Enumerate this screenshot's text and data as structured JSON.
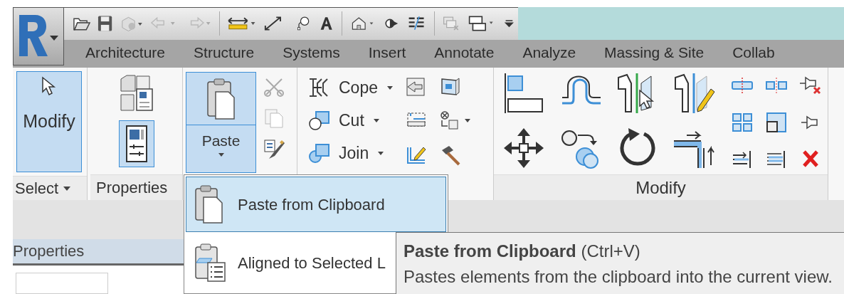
{
  "tabs": [
    {
      "label": "Architecture"
    },
    {
      "label": "Structure"
    },
    {
      "label": "Systems"
    },
    {
      "label": "Insert"
    },
    {
      "label": "Annotate"
    },
    {
      "label": "Analyze"
    },
    {
      "label": "Massing & Site"
    },
    {
      "label": "Collab"
    }
  ],
  "ribbon": {
    "modify_button": {
      "label": "Modify",
      "selected": true
    },
    "select_panel": {
      "label": "Select"
    },
    "properties_panel": {
      "label": "Properties",
      "properties_button_selected": true
    },
    "paste_button": {
      "label": "Paste",
      "selected": true
    },
    "geometry_tools": [
      {
        "label": "Cope"
      },
      {
        "label": "Cut"
      },
      {
        "label": "Join"
      }
    ],
    "modify_panel": {
      "label": "Modify"
    }
  },
  "properties_palette": {
    "title": "Properties"
  },
  "paste_menu": [
    {
      "label": "Paste from Clipboard",
      "selected": true
    },
    {
      "label": "Aligned to Selected L",
      "selected": false
    }
  ],
  "tooltip": {
    "title": "Paste from Clipboard",
    "shortcut": "(Ctrl+V)",
    "description": "Pastes elements from the clipboard into the current view."
  }
}
